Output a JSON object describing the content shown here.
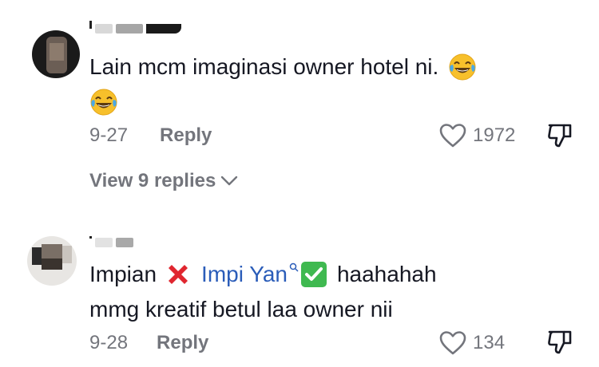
{
  "comments": [
    {
      "text_line1": "Lain mcm imaginasi owner hotel ni.",
      "date": "9-27",
      "reply_label": "Reply",
      "likes": "1972",
      "view_replies": "View 9 replies"
    },
    {
      "word_before": "Impian",
      "mention": "Impi Yan",
      "word_after": "haahahah",
      "text_line2": "mmg kreatif betul laa owner nii",
      "date": "9-28",
      "reply_label": "Reply",
      "likes": "134"
    }
  ],
  "colors": {
    "text": "#161823",
    "meta": "#73757c",
    "mention": "#2b5db9",
    "cross": "#e0262f",
    "check": "#3fb950"
  },
  "icons": [
    "laughing-face-icon",
    "heart-icon",
    "dislike-icon",
    "chevron-down-icon",
    "cross-mark-icon",
    "check-mark-icon",
    "search-icon"
  ]
}
